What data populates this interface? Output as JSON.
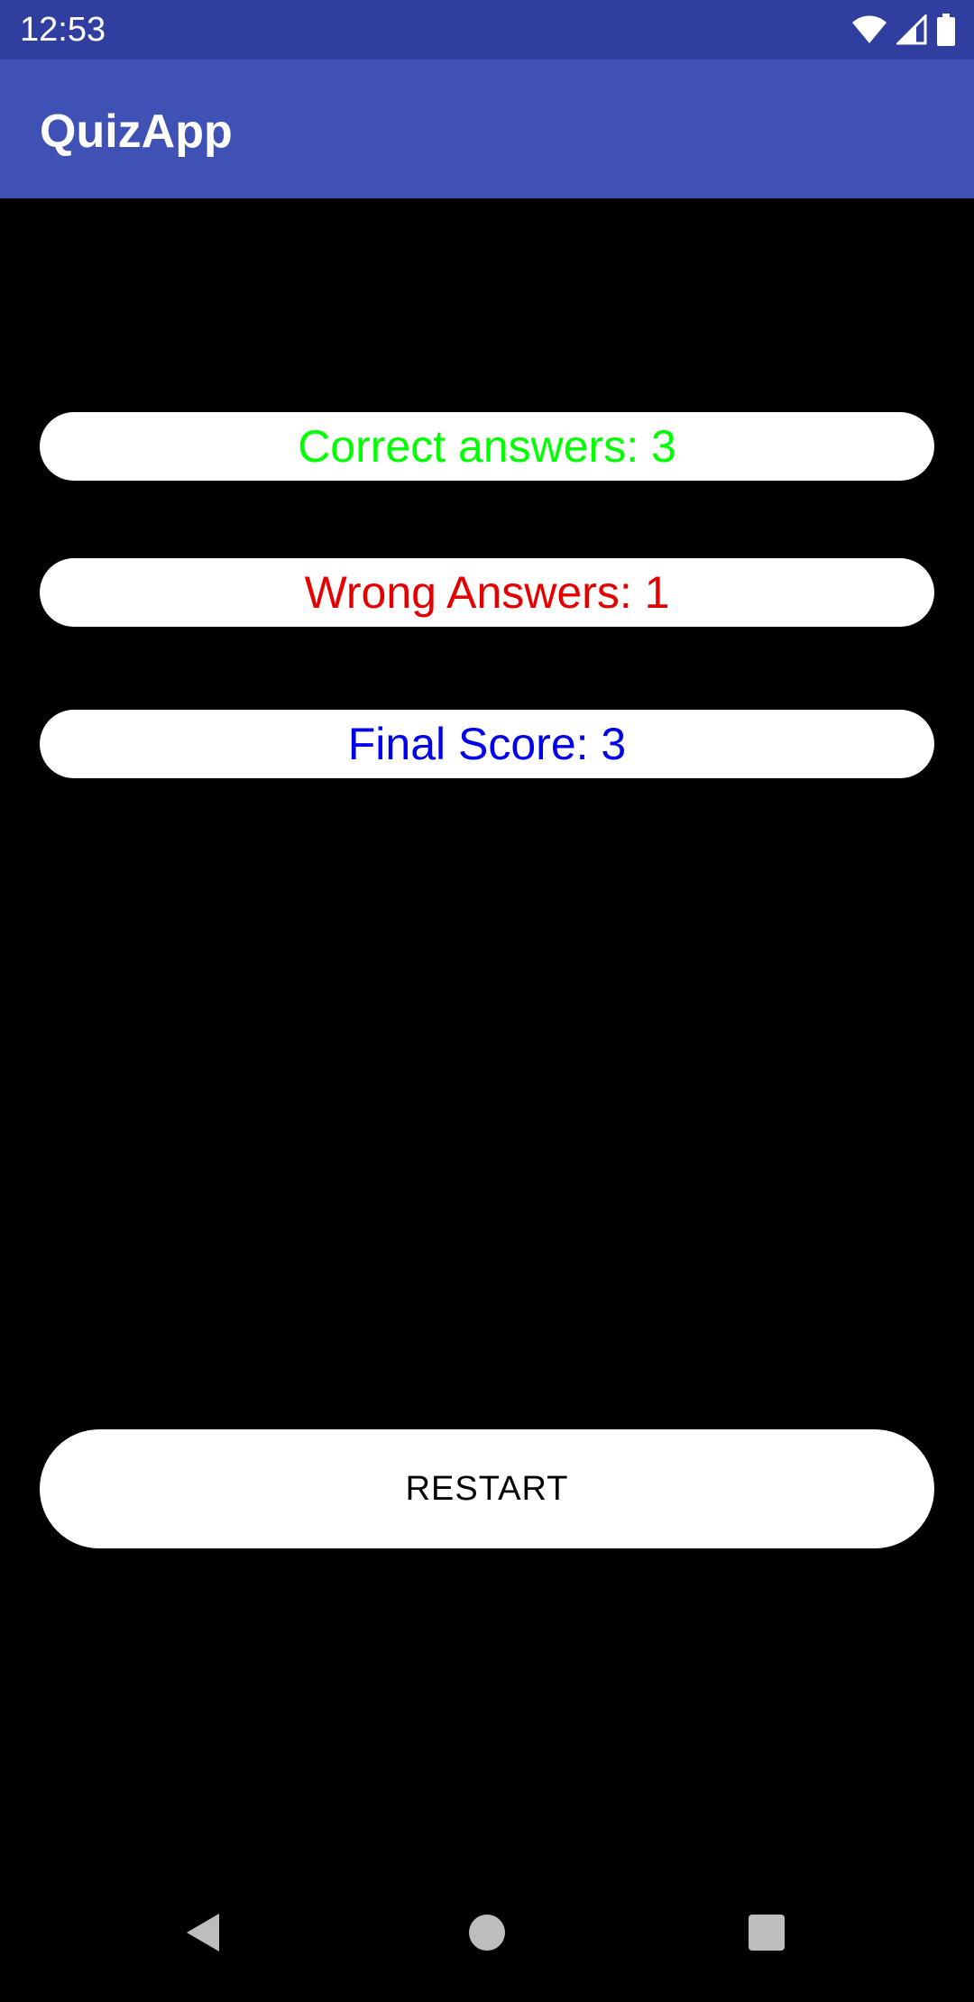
{
  "status_bar": {
    "time": "12:53",
    "icons": [
      "wifi-icon",
      "cell-signal-icon",
      "battery-icon"
    ]
  },
  "app_bar": {
    "title": "QuizApp"
  },
  "results": {
    "correct": {
      "text": "Correct answers: 3",
      "color": "#00FF00"
    },
    "wrong": {
      "text": "Wrong Answers: 1",
      "color": "#E50000"
    },
    "score": {
      "text": "Final Score: 3",
      "color": "#0000EE"
    }
  },
  "restart_button": {
    "label": "RESTART"
  },
  "nav_bar": {
    "buttons": [
      "back-icon",
      "home-icon",
      "recents-icon"
    ]
  },
  "colors": {
    "status_bar": "#303F9F",
    "app_bar": "#3F51B5",
    "background": "#000000",
    "pill": "#FFFFFF"
  }
}
